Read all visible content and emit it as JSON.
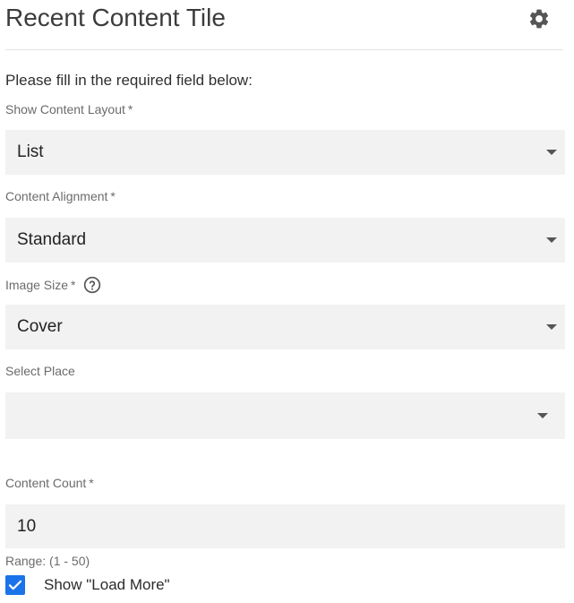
{
  "header": {
    "title": "Recent Content Tile",
    "settings_icon": "gear-icon"
  },
  "form": {
    "intro": "Please fill in the required field below:",
    "required_marker": "*",
    "content_layout": {
      "label": "Show Content Layout",
      "value": "List"
    },
    "content_alignment": {
      "label": "Content Alignment",
      "value": "Standard"
    },
    "image_size": {
      "label": "Image Size",
      "value": "Cover",
      "help_icon": "question-circle-icon"
    },
    "select_place": {
      "label": "Select Place",
      "value": ""
    },
    "content_count": {
      "label": "Content Count",
      "value": "10",
      "hint": "Range: (1 - 50)"
    },
    "load_more": {
      "label": "Show \"Load More\"",
      "checked": true
    }
  },
  "colors": {
    "accent": "#1a73e8",
    "field_bg": "#f2f2f2",
    "label": "#6b6b6b"
  }
}
